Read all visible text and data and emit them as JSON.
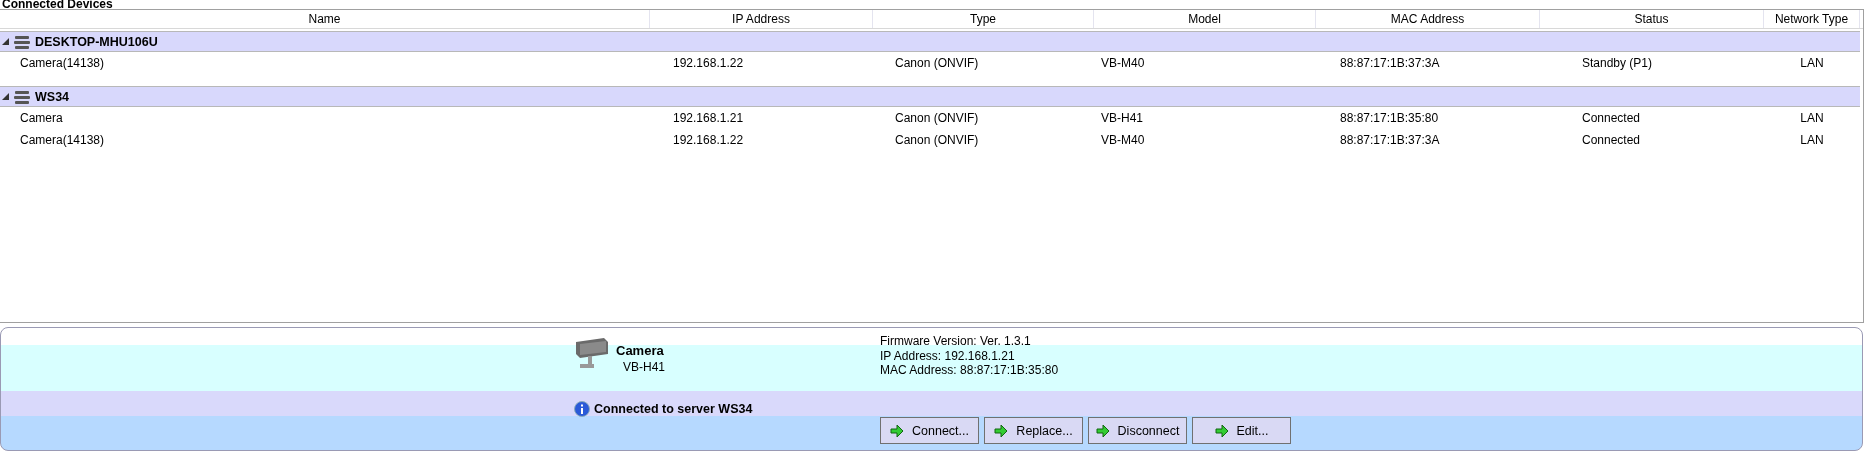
{
  "title": "Connected Devices",
  "table": {
    "columns": [
      "Name",
      "IP Address",
      "Type",
      "Model",
      "MAC Address",
      "Status",
      "Network Type"
    ],
    "groups": [
      {
        "name": "DESKTOP-MHU106U",
        "expanded": true,
        "rows": [
          {
            "cells": [
              "Camera(14138)",
              "192.168.1.22",
              "Canon (ONVIF)",
              "VB-M40",
              "88:87:17:1B:37:3A",
              "Standby (P1)",
              "LAN"
            ]
          }
        ]
      },
      {
        "name": "WS34",
        "expanded": true,
        "rows": [
          {
            "cells": [
              "Camera",
              "192.168.1.21",
              "Canon (ONVIF)",
              "VB-H41",
              "88:87:17:1B:35:80",
              "Connected",
              "LAN"
            ]
          },
          {
            "cells": [
              "Camera(14138)",
              "192.168.1.22",
              "Canon (ONVIF)",
              "VB-M40",
              "88:87:17:1B:37:3A",
              "Connected",
              "LAN"
            ]
          }
        ]
      }
    ]
  },
  "details": {
    "name": "Camera",
    "model": "VB-H41",
    "lines": [
      "Firmware Version: Ver. 1.3.1",
      "IP Address: 192.168.1.21",
      "MAC Address: 88:87:17:1B:35:80"
    ],
    "message": "Connected to server WS34",
    "buttons": [
      "Connect...",
      "Replace...",
      "Disconnect",
      "Edit..."
    ]
  }
}
